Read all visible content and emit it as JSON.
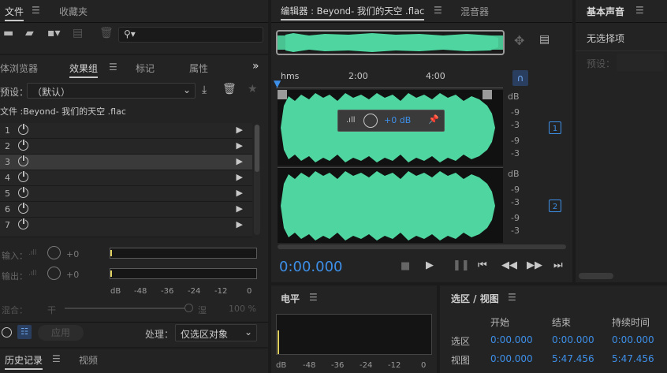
{
  "left_top_tabs": {
    "files": "文件",
    "favorites": "收藏夹"
  },
  "left_mid_tabs": {
    "media_browser": "体浏览器",
    "effects_rack": "效果组",
    "markers": "标记",
    "properties": "属性"
  },
  "effects": {
    "preset_label": "预设：",
    "preset_value": "（默认）",
    "file_label": "文件 :Beyond- 我们的天空 .flac",
    "slots": [
      "1",
      "2",
      "3",
      "4",
      "5",
      "6",
      "7"
    ],
    "input_label": "输入：",
    "output_label": "输出：",
    "input_value": "+0",
    "output_value": "+0",
    "meter_ticks": [
      "dB",
      "-48",
      "-36",
      "-24",
      "-12",
      "0"
    ],
    "mix_label": "混合：",
    "mix_dry": "干",
    "mix_wet": "湿",
    "mix_value": "100 %",
    "apply_label": "应用",
    "process_label": "处理：",
    "process_value": "仅选区对象"
  },
  "bottom_left_tabs": {
    "history": "历史记录",
    "video": "视频"
  },
  "editor": {
    "tab_label": "编辑器 : Beyond- 我们的天空 .flac",
    "mixer_tab": "混音器",
    "timeline": [
      "hms",
      "2:00",
      "4:00"
    ],
    "db_labels_ch1": [
      "dB",
      "-9",
      "-3",
      "-∞",
      "-9",
      "-3"
    ],
    "db_labels_ch2": [
      "dB",
      "-9",
      "-3",
      "-∞",
      "-9",
      "-3"
    ],
    "channel1": "1",
    "channel2": "2",
    "hud_gain": "+0 dB",
    "time_display": "0:00.000"
  },
  "levels": {
    "title": "电平",
    "ticks": [
      "dB",
      "-48",
      "-36",
      "-24",
      "-12",
      "0"
    ]
  },
  "selection_view": {
    "title": "选区 / 视图",
    "headers": [
      "开始",
      "结束",
      "持续时间"
    ],
    "rows": [
      {
        "label": "选区",
        "start": "0:00.000",
        "end": "0:00.000",
        "duration": "0:00.000"
      },
      {
        "label": "视图",
        "start": "0:00.000",
        "end": "5:47.456",
        "duration": "5:47.456"
      }
    ]
  },
  "essential_sound": {
    "title": "基本声音",
    "no_selection": "无选择项",
    "preset_label": "预设："
  },
  "colors": {
    "waveform": "#4fd6a0",
    "accent": "#3d8fe8"
  }
}
